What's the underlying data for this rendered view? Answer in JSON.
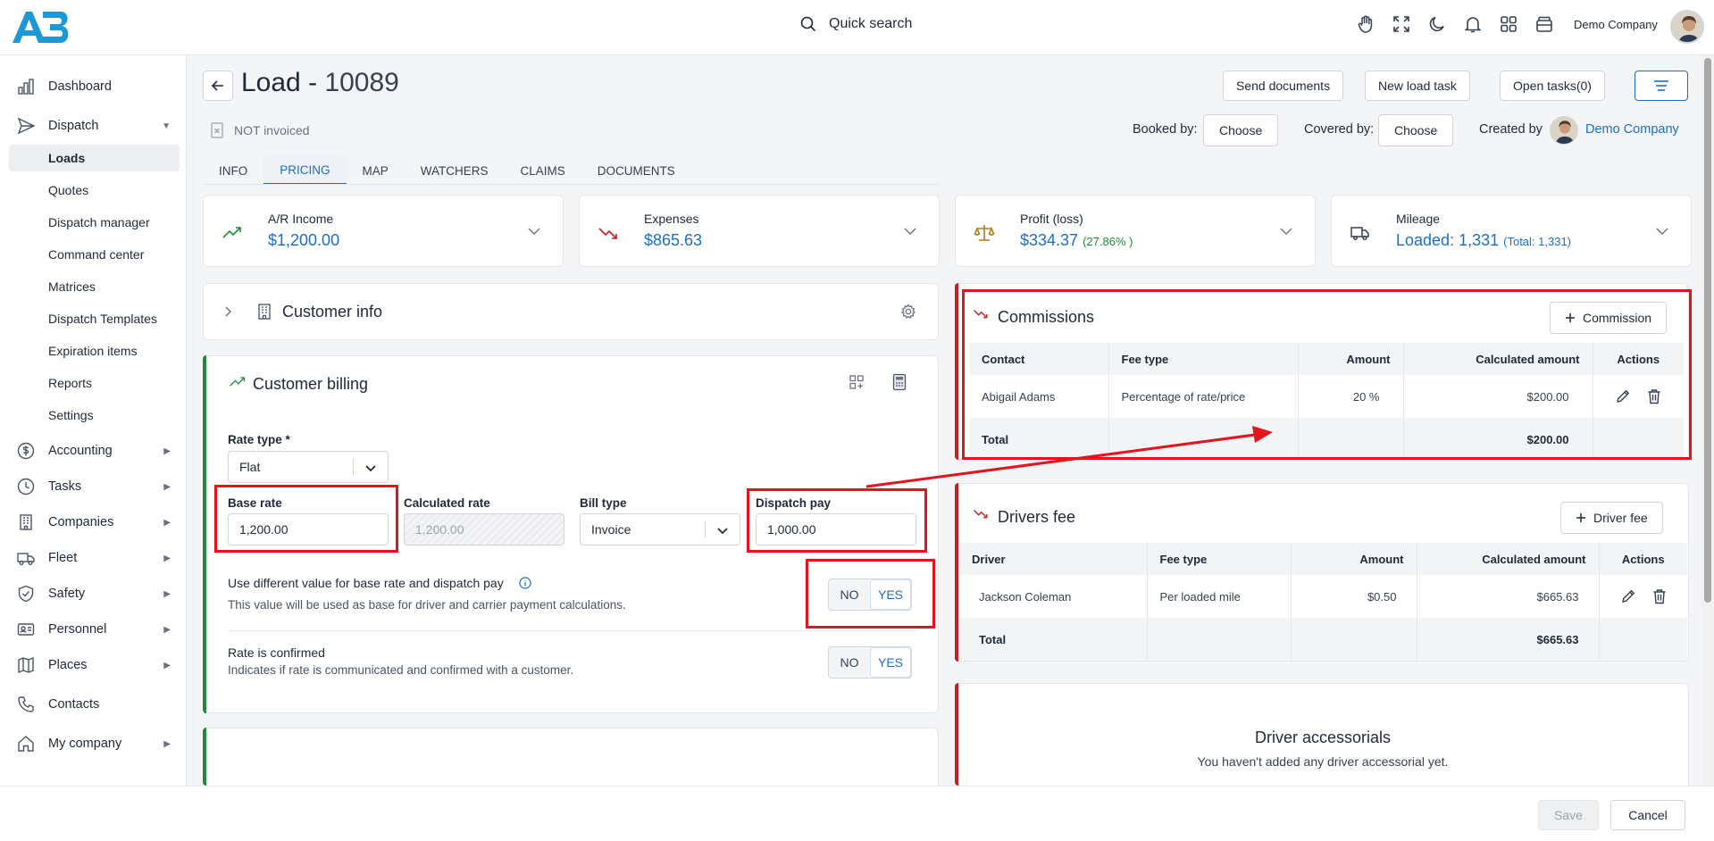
{
  "topbar": {
    "search_label": "Quick search",
    "company_name": "Demo Company"
  },
  "sidebar": {
    "dashboard": "Dashboard",
    "dispatch": "Dispatch",
    "dispatch_children": [
      "Loads",
      "Quotes",
      "Dispatch manager",
      "Command center",
      "Matrices",
      "Dispatch Templates",
      "Expiration items",
      "Reports",
      "Settings"
    ],
    "accounting": "Accounting",
    "tasks": "Tasks",
    "companies": "Companies",
    "fleet": "Fleet",
    "safety": "Safety",
    "personnel": "Personnel",
    "places": "Places",
    "contacts": "Contacts",
    "my_company": "My company"
  },
  "header": {
    "title_prefix": "Load - ",
    "load_number": "10089",
    "send_documents": "Send documents",
    "new_load_task": "New load task",
    "open_tasks": "Open tasks(0)",
    "invoice_status": "NOT invoiced",
    "booked_by_label": "Booked by:",
    "covered_by_label": "Covered by:",
    "choose": "Choose",
    "created_by_label": "Created by",
    "created_by_name": "Demo Company"
  },
  "tabs": [
    "INFO",
    "PRICING",
    "MAP",
    "WATCHERS",
    "CLAIMS",
    "DOCUMENTS"
  ],
  "active_tab": "PRICING",
  "summary": {
    "ar_income_label": "A/R Income",
    "ar_income_value": "$1,200.00",
    "expenses_label": "Expenses",
    "expenses_value": "$865.63",
    "profit_label": "Profit (loss)",
    "profit_value": "$334.37",
    "profit_pct": "(27.86% )",
    "mileage_label": "Mileage",
    "mileage_value": "Loaded: 1,331",
    "mileage_total": "(Total: 1,331)"
  },
  "customer_info": {
    "title": "Customer info"
  },
  "customer_billing": {
    "title": "Customer billing",
    "rate_type_label": "Rate type *",
    "rate_type_value": "Flat",
    "base_rate_label": "Base rate",
    "base_rate_value": "1,200.00",
    "calculated_rate_label": "Calculated rate",
    "calculated_rate_value": "1,200.00",
    "bill_type_label": "Bill type",
    "bill_type_value": "Invoice",
    "dispatch_pay_label": "Dispatch pay",
    "dispatch_pay_value": "1,000.00",
    "diff_value_title": "Use different value for base rate and dispatch pay",
    "diff_value_desc": "This value will be used as base for driver and carrier payment calculations.",
    "rate_confirmed_title": "Rate is confirmed",
    "rate_confirmed_desc": "Indicates if rate is communicated and confirmed with a customer.",
    "no": "NO",
    "yes": "YES"
  },
  "commissions": {
    "title": "Commissions",
    "add_label": "Commission",
    "columns": [
      "Contact",
      "Fee type",
      "Amount",
      "Calculated amount",
      "Actions"
    ],
    "rows": [
      {
        "contact": "Abigail Adams",
        "fee_type": "Percentage of rate/price",
        "amount": "20 %",
        "calculated": "$200.00"
      }
    ],
    "total_label": "Total",
    "total_value": "$200.00"
  },
  "drivers_fee": {
    "title": "Drivers fee",
    "add_label": "Driver fee",
    "columns": [
      "Driver",
      "Fee type",
      "Amount",
      "Calculated amount",
      "Actions"
    ],
    "rows": [
      {
        "driver": "Jackson Coleman",
        "fee_type": "Per loaded mile",
        "amount": "$0.50",
        "calculated": "$665.63"
      }
    ],
    "total_label": "Total",
    "total_value": "$665.63"
  },
  "driver_accessorials": {
    "title": "Driver accessorials",
    "empty_text": "You haven't added any driver accessorial yet."
  },
  "footer": {
    "save": "Save",
    "cancel": "Cancel"
  },
  "colors": {
    "accent": "#1b6fc9",
    "annotation_red": "#e5141c",
    "billing_green": "#1f8a3b"
  }
}
